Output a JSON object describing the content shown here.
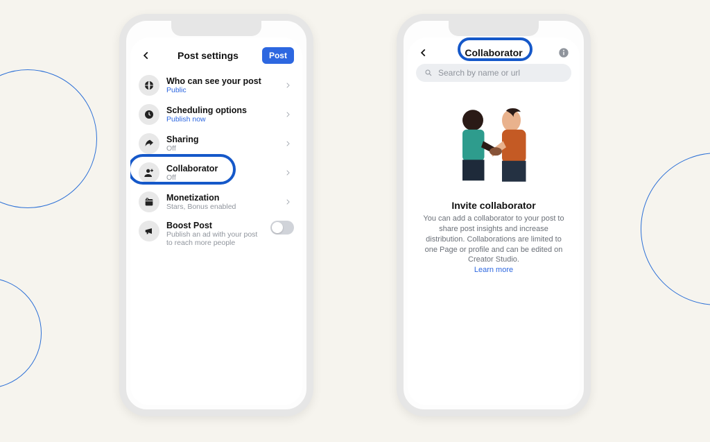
{
  "colors": {
    "accent": "#2d67e0",
    "annotation": "#1558c9"
  },
  "left_phone": {
    "header": {
      "title": "Post settings",
      "post_button": "Post"
    },
    "rows": {
      "visibility": {
        "title": "Who can see your post",
        "sub": "Public"
      },
      "scheduling": {
        "title": "Scheduling options",
        "sub": "Publish now"
      },
      "sharing": {
        "title": "Sharing",
        "sub": "Off"
      },
      "collaborator": {
        "title": "Collaborator",
        "sub": "Off"
      },
      "monetization": {
        "title": "Monetization",
        "sub": "Stars, Bonus enabled"
      },
      "boost": {
        "title": "Boost Post",
        "sub": "Publish an ad with your post to reach more people"
      }
    }
  },
  "right_phone": {
    "header": {
      "title": "Collaborator"
    },
    "search": {
      "placeholder": "Search by name or url"
    },
    "invite": {
      "title": "Invite collaborator",
      "body": "You can add a collaborator to your post to share post insights and increase distribution. Collaborations are limited to one Page or profile and can be edited on Creator Studio.",
      "learn_more": "Learn more"
    }
  }
}
